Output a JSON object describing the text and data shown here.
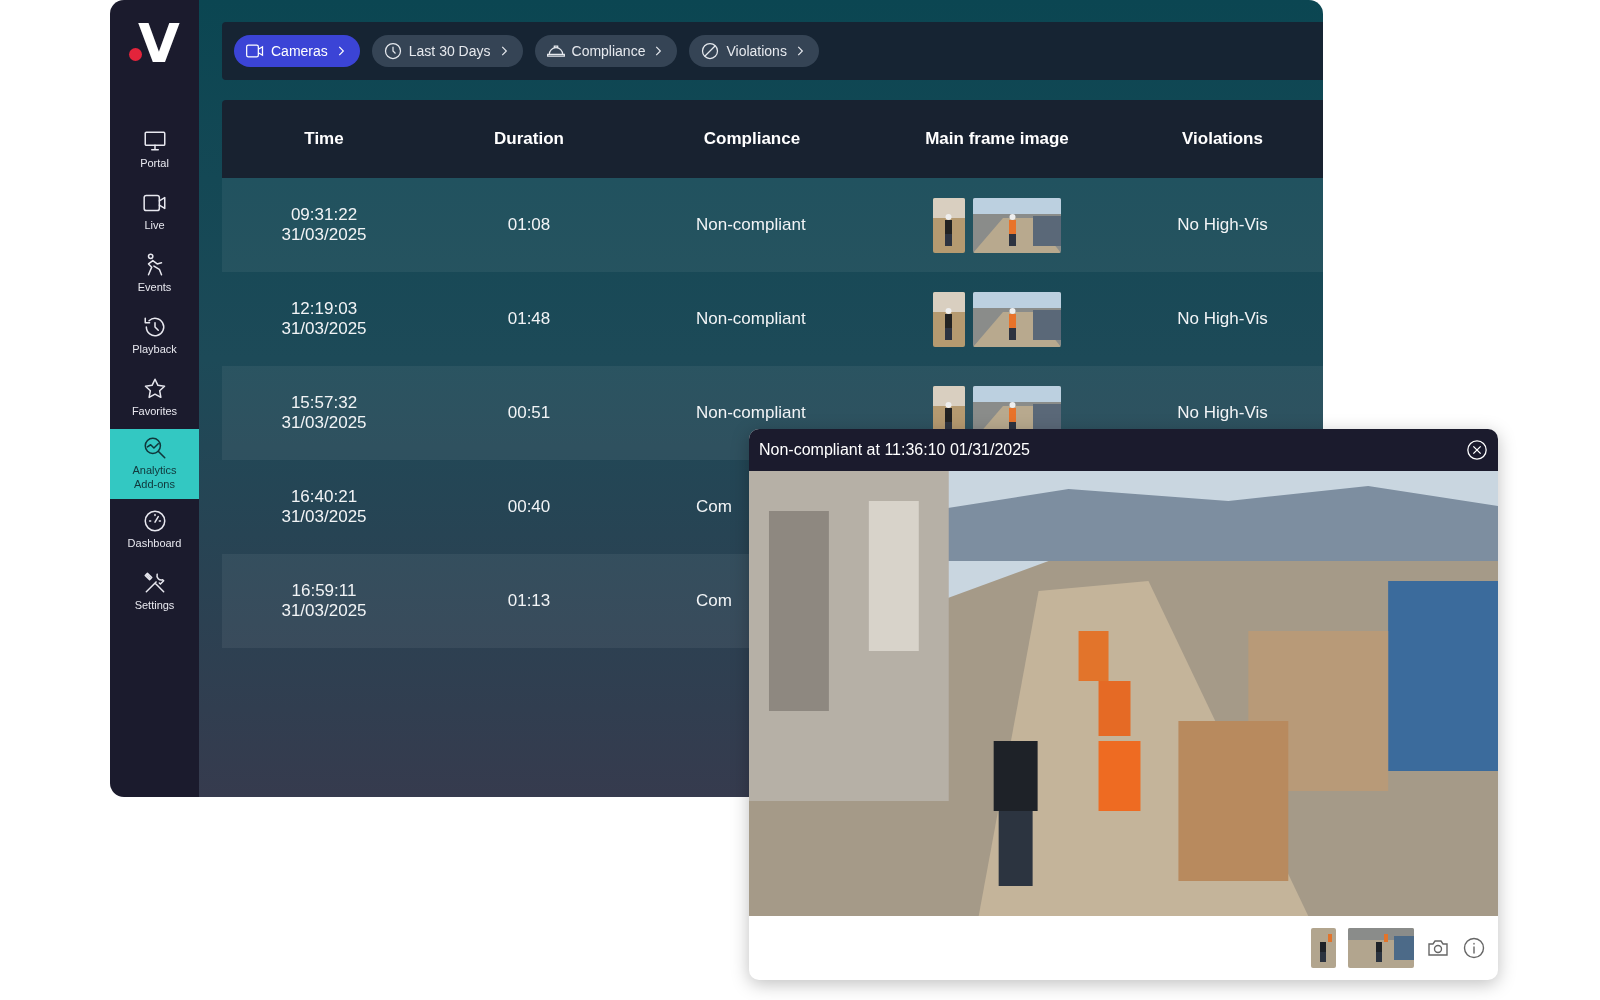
{
  "logo": {
    "text": "V"
  },
  "sidebar": {
    "items": [
      {
        "label": "Portal",
        "selected": false
      },
      {
        "label": "Live",
        "selected": false
      },
      {
        "label": "Events",
        "selected": false
      },
      {
        "label": "Playback",
        "selected": false
      },
      {
        "label": "Favorites",
        "selected": false
      },
      {
        "label": "Analytics Add-ons",
        "selected": true
      },
      {
        "label": "Dashboard",
        "selected": false
      },
      {
        "label": "Settings",
        "selected": false
      }
    ]
  },
  "filters": [
    {
      "label": "Cameras",
      "selected": true
    },
    {
      "label": "Last 30 Days",
      "selected": false
    },
    {
      "label": "Compliance",
      "selected": false
    },
    {
      "label": "Violations",
      "selected": false
    }
  ],
  "table": {
    "columns": [
      "Time",
      "Duration",
      "Compliance",
      "Main frame image",
      "Violations"
    ],
    "rows": [
      {
        "time": "09:31:22",
        "date": "31/03/2025",
        "duration": "01:08",
        "compliance": "Non-compliant",
        "violation": "No High-Vis"
      },
      {
        "time": "12:19:03",
        "date": "31/03/2025",
        "duration": "01:48",
        "compliance": "Non-compliant",
        "violation": "No High-Vis"
      },
      {
        "time": "15:57:32",
        "date": "31/03/2025",
        "duration": "00:51",
        "compliance": "Non-compliant",
        "violation": "No High-Vis"
      },
      {
        "time": "16:40:21",
        "date": "31/03/2025",
        "duration": "00:40",
        "compliance": "Com"
      },
      {
        "time": "16:59:11",
        "date": "31/03/2025",
        "duration": "01:13",
        "compliance": "Com"
      }
    ]
  },
  "popup": {
    "title": "Non-compliant at 11:36:10 01/31/2025"
  }
}
